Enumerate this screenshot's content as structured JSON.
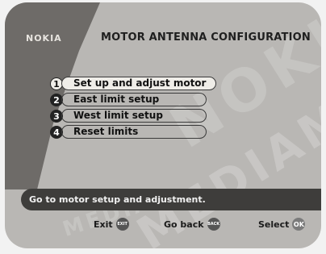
{
  "header": {
    "brand": "NOKIA",
    "title": "MOTOR ANTENNA CONFIGURATION"
  },
  "menu": {
    "items": [
      {
        "number": "1",
        "label": "Set up and adjust motor"
      },
      {
        "number": "2",
        "label": "East limit setup"
      },
      {
        "number": "3",
        "label": "West limit setup"
      },
      {
        "number": "4",
        "label": "Reset limits"
      }
    ]
  },
  "status_text": "Go to motor setup and adjustment.",
  "help": {
    "exit": {
      "label": "Exit",
      "key": "EXIT"
    },
    "back": {
      "label": "Go back",
      "key": "BACK"
    },
    "select": {
      "label": "Select",
      "key": "OK"
    }
  },
  "watermark": {
    "big": "NOKIA",
    "medium": "MEDIAMASTER",
    "small": "MEDIA"
  }
}
